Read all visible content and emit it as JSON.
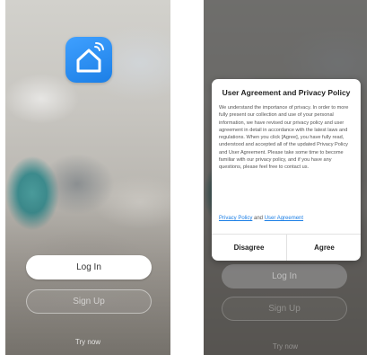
{
  "left_screen": {
    "logo_icon": "home-icon",
    "login_label": "Log In",
    "signup_label": "Sign Up",
    "try_now_label": "Try now"
  },
  "right_screen": {
    "login_label": "Log In",
    "signup_label": "Sign Up",
    "try_now_label": "Try now",
    "dialog": {
      "title": "User Agreement and Privacy Policy",
      "body": "We understand the importance of privacy. In order to more fully present our collection and use of your personal information, we have revised our privacy policy and user agreement in detail in accordance with the latest laws and regulations. When you click [Agree], you have fully read, understood and accepted all of the updated Privacy Policy and User Agreement. Please take some time to become familiar with our privacy policy, and if you have any questions, please feel free to contact us.",
      "privacy_link": "Privacy Policy",
      "and_text": " and ",
      "agreement_link": "User Agreement",
      "disagree_label": "Disagree",
      "agree_label": "Agree"
    }
  },
  "colors": {
    "accent": "#1c7fe6",
    "logo_bg": "#3fa0ff"
  }
}
